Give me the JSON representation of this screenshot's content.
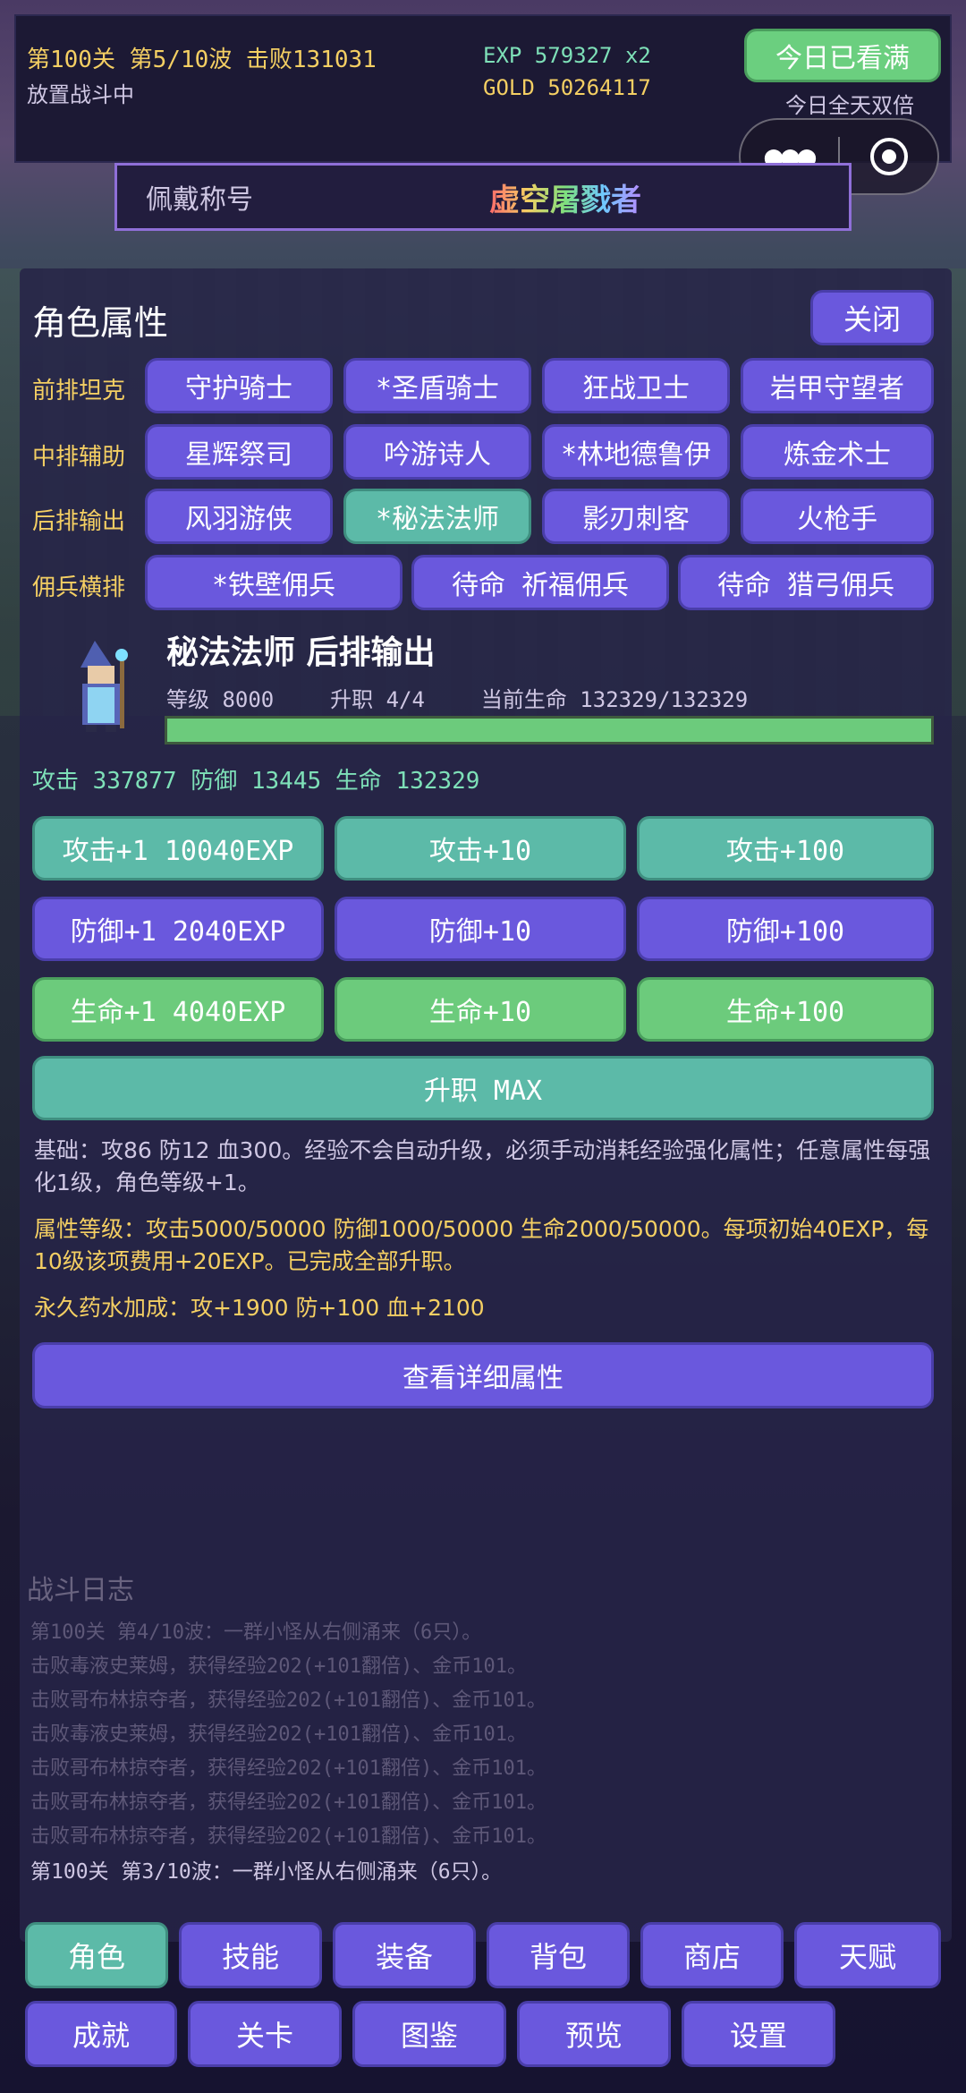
{
  "header": {
    "wave_info": "第100关 第5/10波  击败131031",
    "status": "放置战斗中",
    "exp": "EXP 579327 x2",
    "gold": "GOLD 50264117",
    "watch_button": "今日已看满",
    "double_note": "今日全天双倍"
  },
  "title_bar": {
    "label": "佩戴称号",
    "value": "虚空屠戮者"
  },
  "panel": {
    "title": "角色属性",
    "close": "关闭",
    "rows": [
      {
        "label": "前排坦克",
        "classes": [
          "守护骑士",
          "*圣盾骑士",
          "狂战卫士",
          "岩甲守望者"
        ]
      },
      {
        "label": "中排辅助",
        "classes": [
          "星辉祭司",
          "吟游诗人",
          "*林地德鲁伊",
          "炼金术士"
        ]
      },
      {
        "label": "后排输出",
        "classes": [
          "风羽游侠",
          "*秘法法师",
          "影刃刺客",
          "火枪手"
        ]
      },
      {
        "label": "佣兵横排",
        "classes": [
          "*铁壁佣兵",
          "待命 祈福佣兵",
          "待命 猎弓佣兵"
        ]
      }
    ],
    "selected_class": "*秘法法师"
  },
  "hero": {
    "name": "秘法法师   后排输出",
    "level": "等级 8000",
    "promotion": "升职 4/4",
    "hp": "当前生命 132329/132329",
    "hp_ratio": 1.0,
    "stats_line": "攻击 337877  防御 13445  生命 132329"
  },
  "upgrades": {
    "atk": [
      "攻击+1 10040EXP",
      "攻击+10",
      "攻击+100"
    ],
    "def": [
      "防御+1 2040EXP",
      "防御+10",
      "防御+100"
    ],
    "hp": [
      "生命+1 4040EXP",
      "生命+10",
      "生命+100"
    ],
    "promote": "升职 MAX"
  },
  "info": {
    "base": "基础：攻86 防12 血300。经验不会自动升级，必须手动消耗经验强化属性；任意属性每强化1级，角色等级+1。",
    "levels": "属性等级：攻击5000/50000 防御1000/50000 生命2000/50000。每项初始40EXP，每10级该项费用+20EXP。已完成全部升职。",
    "potion": "永久药水加成：攻+1900 防+100 血+2100",
    "detail_button": "查看详细属性"
  },
  "log": {
    "title": "战斗日志",
    "lines": [
      "第100关 第4/10波：一群小怪从右侧涌来（6只）。",
      "击败毒液史莱姆，获得经验202(+101翻倍)、金币101。",
      "击败哥布林掠夺者，获得经验202(+101翻倍)、金币101。",
      "击败毒液史莱姆，获得经验202(+101翻倍)、金币101。",
      "击败哥布林掠夺者，获得经验202(+101翻倍)、金币101。",
      "击败哥布林掠夺者，获得经验202(+101翻倍)、金币101。",
      "击败哥布林掠夺者，获得经验202(+101翻倍)、金币101。",
      "第100关 第3/10波：一群小怪从右侧涌来（6只）。"
    ]
  },
  "nav": {
    "row1": [
      "角色",
      "技能",
      "装备",
      "背包",
      "商店",
      "天赋"
    ],
    "row2": [
      "成就",
      "关卡",
      "图鉴",
      "预览",
      "设置"
    ],
    "active": "角色"
  },
  "colors": {
    "purple": "#6a58dd",
    "teal": "#5cbaa8",
    "green": "#6ccb7c",
    "gold": "#f4cf63",
    "mint": "#7ee0b8"
  }
}
